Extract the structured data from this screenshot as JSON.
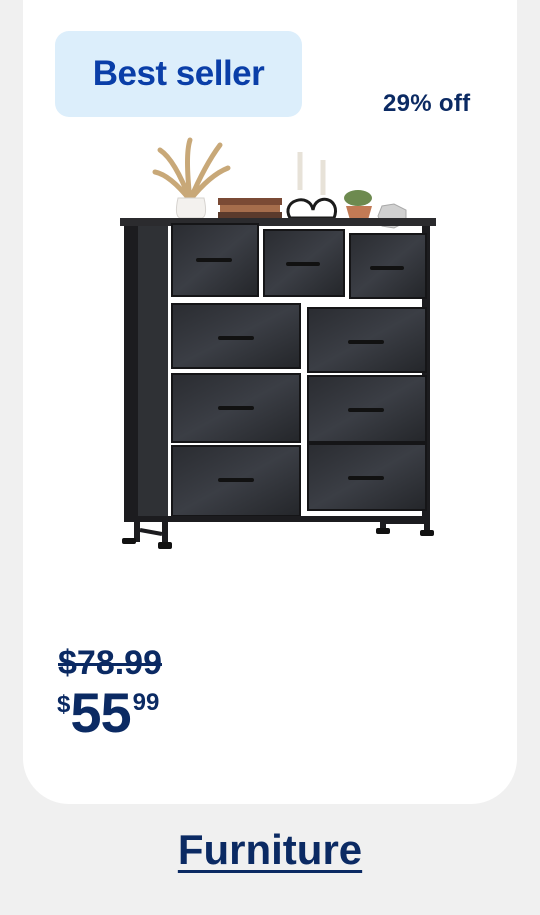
{
  "badge": {
    "label": "Best seller"
  },
  "discount": {
    "label": "29% off"
  },
  "product": {
    "image_icon": "dresser-image"
  },
  "pricing": {
    "was": "$78.99",
    "currency": "$",
    "dollars": "55",
    "cents": "99"
  },
  "category": {
    "label": "Furniture"
  },
  "colors": {
    "brand_blue": "#0a3ea8",
    "badge_bg": "#dceefb",
    "text_navy": "#0b2a63",
    "page_bg": "#f0f0f0"
  }
}
